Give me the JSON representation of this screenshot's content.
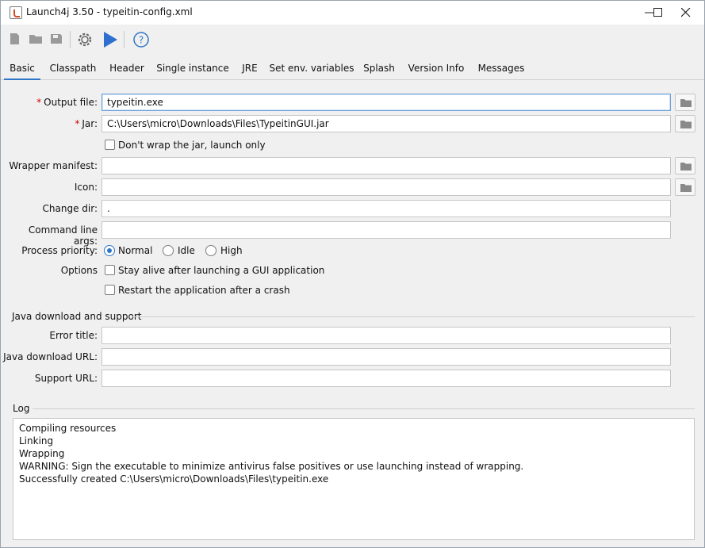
{
  "window": {
    "title": "Launch4j 3.50 - typeitin-config.xml"
  },
  "toolbar": {
    "icons": [
      "new-icon",
      "open-icon",
      "save-icon",
      "build-wrapper-gear-icon",
      "run-play-icon",
      "help-icon"
    ]
  },
  "tabs": [
    "Basic",
    "Classpath",
    "Header",
    "Single instance",
    "JRE",
    "Set env. variables",
    "Splash",
    "Version Info",
    "Messages"
  ],
  "basic": {
    "output_file": {
      "label": "Output file:",
      "value": "typeitin.exe"
    },
    "jar": {
      "label": "Jar:",
      "value": "C:\\Users\\micro\\Downloads\\Files\\TypeitinGUI.jar"
    },
    "dont_wrap": {
      "label": "Don't wrap the jar, launch only",
      "checked": false
    },
    "wrapper_manifest": {
      "label": "Wrapper manifest:",
      "value": ""
    },
    "icon": {
      "label": "Icon:",
      "value": ""
    },
    "change_dir": {
      "label": "Change dir:",
      "value": "."
    },
    "cmd_args": {
      "label": "Command line args:",
      "value": ""
    },
    "priority": {
      "label": "Process priority:",
      "options": [
        "Normal",
        "Idle",
        "High"
      ],
      "selected": "Normal"
    },
    "options_label": "Options",
    "stay_alive": {
      "label": "Stay alive after launching a GUI application",
      "checked": false
    },
    "restart": {
      "label": "Restart the application after a crash",
      "checked": false
    },
    "java_section": "Java download and support",
    "error_title": {
      "label": "Error title:",
      "value": ""
    },
    "java_url": {
      "label": "Java download URL:",
      "value": ""
    },
    "support_url": {
      "label": "Support URL:",
      "value": ""
    }
  },
  "log": {
    "title": "Log",
    "lines": [
      "Compiling resources",
      "Linking",
      "Wrapping",
      "WARNING: Sign the executable to minimize antivirus false positives or use launching instead of wrapping.",
      "Successfully created C:\\Users\\micro\\Downloads\\Files\\typeitin.exe"
    ]
  },
  "colors": {
    "accent": "#2f76c6",
    "required": "#cc0000"
  }
}
